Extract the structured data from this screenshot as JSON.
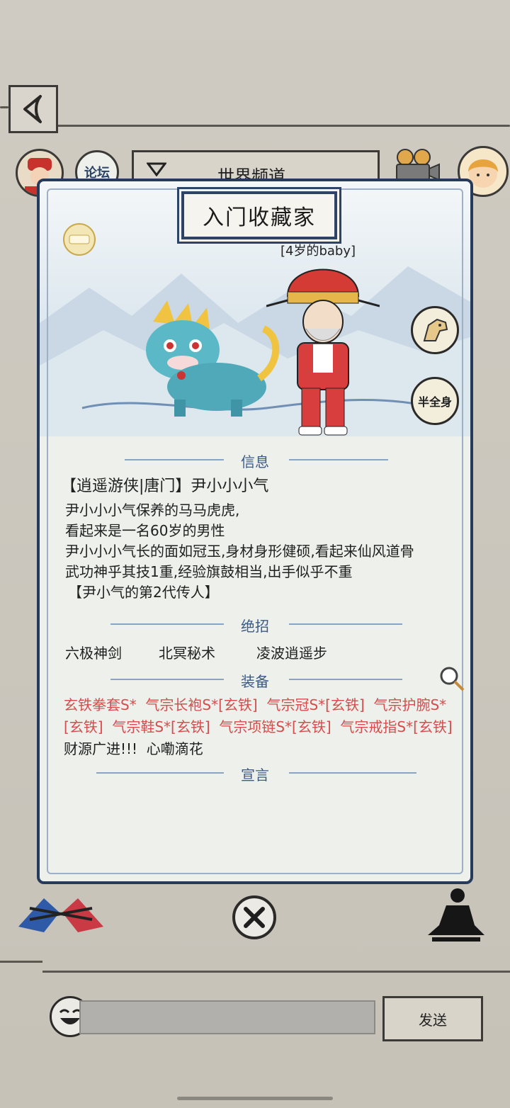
{
  "header": {
    "channel_label": "世界频道",
    "forum_label": "论坛"
  },
  "card": {
    "title": "入门收藏家",
    "age_label": "[4岁的baby]",
    "half_full_body_label": "半全身",
    "sections": {
      "info": "信息",
      "skills": "绝招",
      "equipment": "装备",
      "declaration": "宣言"
    },
    "info": {
      "name_line": "【逍遥游侠|唐门】尹小小小气",
      "lines": [
        "尹小小小气保养的马马虎虎,",
        "看起来是一名60岁的男性",
        "尹小小小气长的面如冠玉,身材身形健硕,看起来仙风道骨",
        "武功神乎其技1重,经验旗鼓相当,出手似乎不重",
        "【尹小气的第2代传人】"
      ]
    },
    "skills": [
      "六极神剑",
      "北冥秘术",
      "凌波逍遥步"
    ],
    "equipment": [
      {
        "text": "玄铁拳套S*",
        "color": "red"
      },
      {
        "text": "气宗长袍S*[玄铁]",
        "color": "red"
      },
      {
        "text": "气宗冠S*[玄铁]",
        "color": "red"
      },
      {
        "text": "气宗护腕S*[玄铁]",
        "color": "red"
      },
      {
        "text": "气宗鞋S*[玄铁]",
        "color": "red"
      },
      {
        "text": "气宗项链S*[玄铁]",
        "color": "red"
      },
      {
        "text": "气宗戒指S*[玄铁]",
        "color": "red"
      },
      {
        "text": "财源广进!!!",
        "color": "black"
      },
      {
        "text": "心嘞滴花",
        "color": "black"
      }
    ]
  },
  "chat": {
    "send_label": "发送",
    "input_value": ""
  },
  "colors": {
    "background": "#c9c5bc",
    "panel_border": "#263a5a",
    "section_heading": "#3b5a86",
    "equipment_red": "#d64c4c"
  }
}
